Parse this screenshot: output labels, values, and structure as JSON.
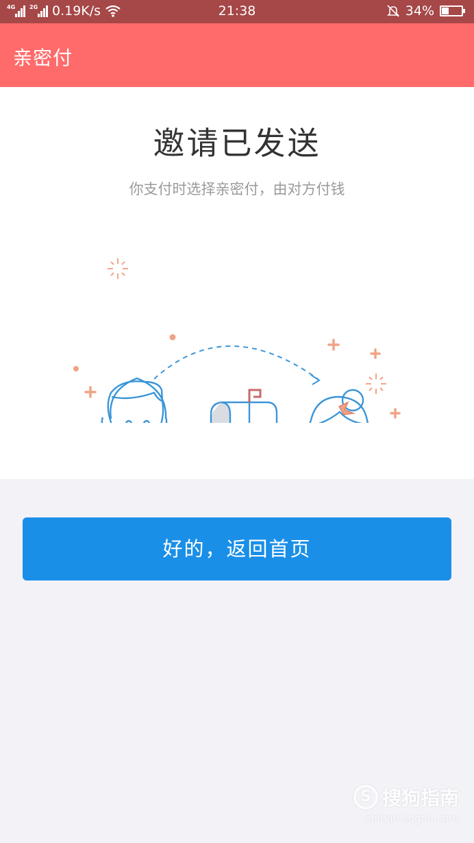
{
  "status_bar": {
    "network_1": "4G",
    "network_2": "2G",
    "speed": "0.19K/s",
    "time": "21:38",
    "battery": "34%",
    "battery_level": 0.34,
    "icons": [
      "signal-icon",
      "wifi-icon",
      "bell-muted-icon",
      "battery-icon"
    ]
  },
  "app_bar": {
    "title": "亲密付"
  },
  "main": {
    "headline": "邀请已发送",
    "subtitle": "你支付时选择亲密付，由对方付钱"
  },
  "actions": {
    "confirm_label": "好的，返回首页"
  },
  "watermark": {
    "brand": "搜狗指南",
    "logo_letter": "S",
    "url": "zhinan.sogou.com"
  },
  "colors": {
    "status_bar": "#a64748",
    "app_bar": "#ff6b6b",
    "primary": "#1a8fe8",
    "line_art": "#3b95d8",
    "accent": "#f0a487"
  }
}
